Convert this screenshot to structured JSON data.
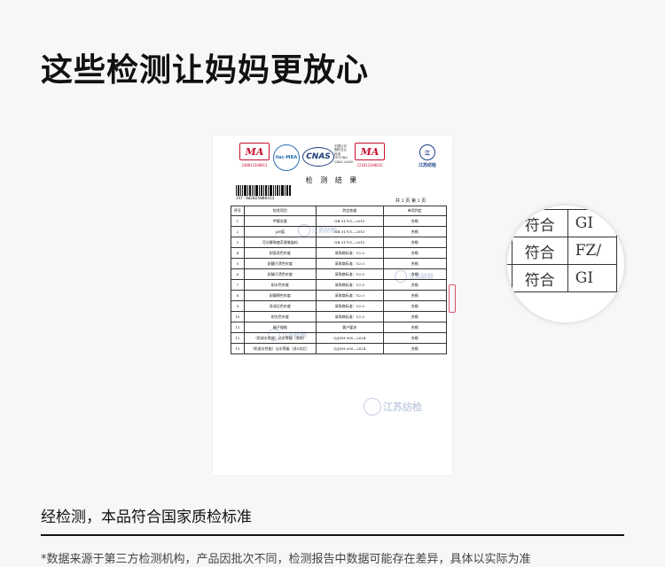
{
  "headline": "这些检测让妈妈更放心",
  "report": {
    "logos": {
      "ma_left": "MA",
      "ma_left_code": "240011340011",
      "ilac_text": "ilac-MRA",
      "cnas_word": "CNAS",
      "cnas_side": [
        "中国认可",
        "国际互认",
        "检测",
        "TESTING",
        "CNAS L0450"
      ],
      "ma_right": "MA",
      "ma_right_code": "221011340632",
      "brand_text": "江苏纺检"
    },
    "title": "检 测 结 果",
    "report_no": "JST-SW2025008313",
    "page_info": "共 2 页   第 2 页",
    "headers": [
      "序号",
      "检验项目",
      "判定依据",
      "单项判定"
    ],
    "rows": [
      [
        "1",
        "甲醛含量",
        "GB 31701—2015",
        "合格"
      ],
      [
        "2",
        "pH值",
        "GB 31701—2015",
        "合格"
      ],
      [
        "3",
        "可分解致癌芳香胺染料",
        "GB 31701—2015",
        "合格"
      ],
      [
        "4",
        "耐皂洗色牢度",
        "采购商标准：V2.0",
        "合格"
      ],
      [
        "5",
        "耐酸汗渍色牢度",
        "采购商标准：V2.0",
        "合格"
      ],
      [
        "6",
        "耐碱汗渍色牢度",
        "采购商标准：V2.0",
        "合格"
      ],
      [
        "7",
        "耐水色牢度",
        "采购商标准：V2.0",
        "合格"
      ],
      [
        "8",
        "耐摩擦色牢度",
        "采购商标准：V2.0",
        "合格"
      ],
      [
        "9",
        "洗涤后色牢度",
        "采购商标准：V2.0",
        "合格"
      ],
      [
        "10",
        "耐光色牢度",
        "采购商标准：V2.0",
        "合格"
      ],
      [
        "11",
        "绳子规格",
        "客户要求",
        "合格"
      ],
      [
        "12",
        "（防泼水性能）沾水等级（洗前）",
        "Q/JSM 000—2024",
        "合格"
      ],
      [
        "13",
        "（防泼水性能）沾水等级（洗5次后）",
        "Q/JSM 000—2024",
        "合格"
      ]
    ],
    "watermark": "江苏纺检"
  },
  "magnifier": {
    "rows": [
      [
        "",
        "符合",
        "GI"
      ],
      [
        "",
        "符合",
        "FZ/"
      ],
      [
        "",
        "符合",
        "GI"
      ]
    ]
  },
  "caption": "经检测，本品符合国家质检标准",
  "disclaimer": "*数据来源于第三方检测机构，产品因批次不同，检测报告中数据可能存在差异，具体以实际为准",
  "colors": {
    "background": "#f7f7f7",
    "ma_red": "#c8102e",
    "cnas_blue": "#1d3c78",
    "brand_blue": "#1b3f8b"
  }
}
